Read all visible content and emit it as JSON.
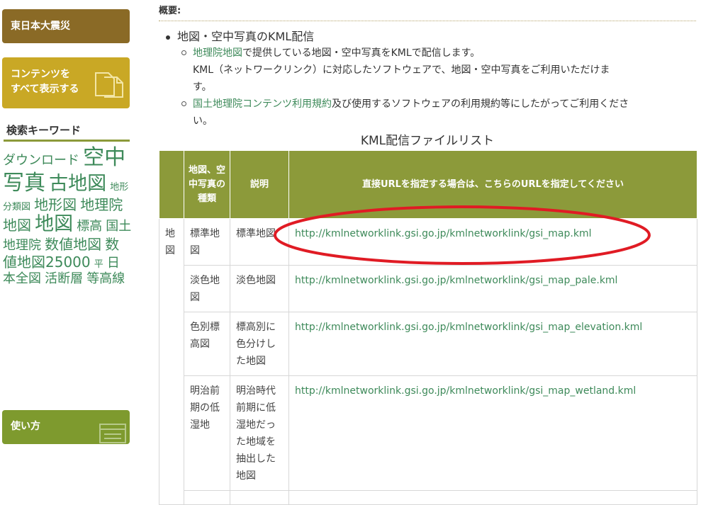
{
  "sidebar": {
    "disaster_label": "東日本大震災",
    "contents_label_1": "コンテンツを",
    "contents_label_2": "すべて表示する",
    "keyword_heading": "検索キーワード",
    "keywords": [
      {
        "text": "ダウンロード",
        "size": "m"
      },
      {
        "text": "空中写真",
        "size": "xxl"
      },
      {
        "text": "古地図",
        "size": "xl"
      },
      {
        "text": "地形分類図",
        "size": "s"
      },
      {
        "text": "地形図",
        "size": "l"
      },
      {
        "text": "地理院地図",
        "size": "l"
      },
      {
        "text": "地図",
        "size": "xl"
      },
      {
        "text": "標高",
        "size": "m"
      },
      {
        "text": "国土地理院",
        "size": "m"
      },
      {
        "text": "数値地図",
        "size": "l"
      },
      {
        "text": "数値地図25000",
        "size": "l"
      },
      {
        "text": "平",
        "size": "s"
      },
      {
        "text": "日本全図",
        "size": "m"
      },
      {
        "text": "活断層",
        "size": "m"
      },
      {
        "text": "等高線",
        "size": "m"
      }
    ],
    "usage_label": "使い方"
  },
  "main": {
    "overview_label": "概要:",
    "bullet_title": "地図・空中写真のKML配信",
    "sub1_link": "地理院地図",
    "sub1_text": "で提供している地図・空中写真をKMLで配信します。",
    "sub1_line2": "KML（ネットワークリンク）に対応したソフトウェアで、地図・空中写真をご利用いただけま",
    "sub1_line3": "す。",
    "sub2_link": "国土地理院コンテンツ利用規約",
    "sub2_text": "及び使用するソフトウェアの利用規約等にしたがってご利用くださ",
    "sub2_line2": "い。",
    "table_caption": "KML配信ファイルリスト",
    "table": {
      "headers": [
        "",
        "地図、空中写真の種類",
        "説明",
        "直接URLを指定する場合は、こちらのURLを指定してください"
      ],
      "group_label": "地図",
      "rows": [
        {
          "type": "標準地図",
          "desc": "標準地図",
          "url": "http://kmlnetworklink.gsi.go.jp/kmlnetworklink/gsi_map.kml"
        },
        {
          "type": "淡色地図",
          "desc": "淡色地図",
          "url": "http://kmlnetworklink.gsi.go.jp/kmlnetworklink/gsi_map_pale.kml"
        },
        {
          "type": "色別標高図",
          "desc": "標高別に色分けした地図",
          "url": "http://kmlnetworklink.gsi.go.jp/kmlnetworklink/gsi_map_elevation.kml"
        },
        {
          "type": "明治前期の低湿地",
          "desc": "明治時代前期に低湿地だった地域を抽出した地図",
          "url": "http://kmlnetworklink.gsi.go.jp/kmlnetworklink/gsi_map_wetland.kml"
        }
      ]
    }
  },
  "colors": {
    "disaster_btn": "#8a6a26",
    "contents_btn": "#c9a825",
    "usage_btn": "#7e9a2e",
    "table_header": "#8c9a3a",
    "link": "#3e8a5a",
    "highlight_ellipse": "#e01b24"
  }
}
